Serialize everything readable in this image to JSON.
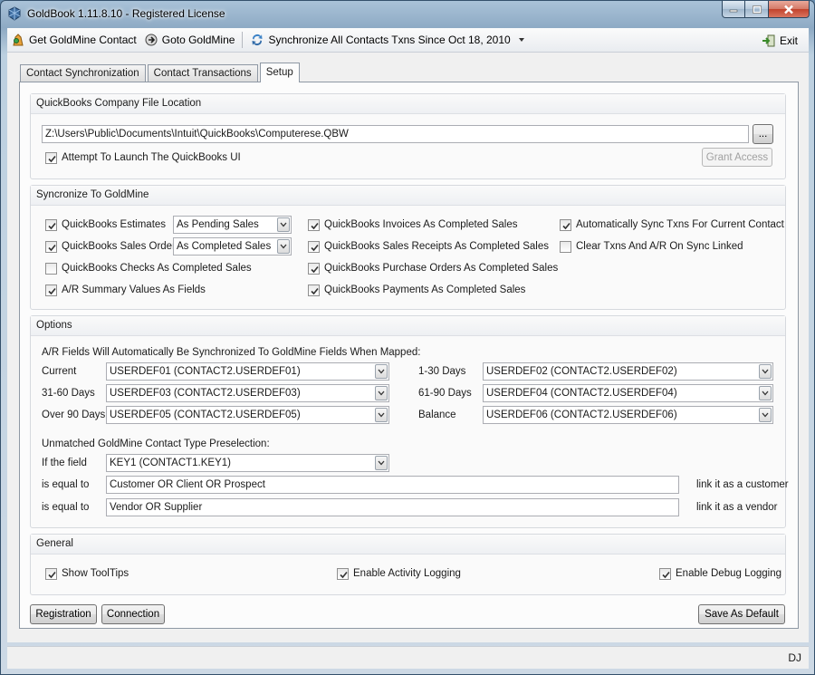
{
  "window": {
    "title": "GoldBook 1.11.8.10 - Registered License"
  },
  "toolbar": {
    "get_contact": "Get GoldMine Contact",
    "goto": "Goto GoldMine",
    "sync_all": "Synchronize All Contacts Txns Since Oct 18, 2010",
    "exit": "Exit"
  },
  "tabs": [
    {
      "label": "Contact Synchronization",
      "active": false
    },
    {
      "label": "Contact Transactions",
      "active": false
    },
    {
      "label": "Setup",
      "active": true
    }
  ],
  "company_file": {
    "header": "QuickBooks Company File Location",
    "path": "Z:\\Users\\Public\\Documents\\Intuit\\QuickBooks\\Computerese.QBW",
    "browse_label": "...",
    "launch_ui_label": "Attempt To Launch The QuickBooks UI",
    "launch_ui_checked": true,
    "grant_access_label": "Grant Access"
  },
  "sync": {
    "header": "Syncronize To GoldMine",
    "estimates": {
      "label": "QuickBooks Estimates",
      "checked": true,
      "mode": "As Pending Sales"
    },
    "sales_orders": {
      "label": "QuickBooks Sales Orders",
      "checked": true,
      "mode": "As Completed Sales"
    },
    "checks": {
      "label": "QuickBooks Checks As Completed Sales",
      "checked": false
    },
    "ar_summary": {
      "label": "A/R Summary Values As Fields",
      "checked": true
    },
    "invoices": {
      "label": "QuickBooks Invoices As Completed Sales",
      "checked": true
    },
    "sales_receipts": {
      "label": "QuickBooks Sales Receipts As Completed Sales",
      "checked": true
    },
    "purchase_orders": {
      "label": "QuickBooks Purchase Orders As Completed Sales",
      "checked": true
    },
    "payments": {
      "label": "QuickBooks Payments As Completed Sales",
      "checked": true
    },
    "auto_sync": {
      "label": "Automatically Sync Txns For Current Contact",
      "checked": true
    },
    "clear_txns": {
      "label": "Clear Txns And A/R On Sync Linked",
      "checked": false
    }
  },
  "options": {
    "header": "Options",
    "ar_note": "A/R Fields Will Automatically Be Synchronized To GoldMine Fields When Mapped:",
    "current": {
      "label": "Current",
      "value": "USERDEF01 (CONTACT2.USERDEF01)"
    },
    "d31_60": {
      "label": "31-60 Days",
      "value": "USERDEF03 (CONTACT2.USERDEF03)"
    },
    "over90": {
      "label": "Over 90 Days",
      "value": "USERDEF05 (CONTACT2.USERDEF05)"
    },
    "d1_30": {
      "label": "1-30 Days",
      "value": "USERDEF02 (CONTACT2.USERDEF02)"
    },
    "d61_90": {
      "label": "61-90 Days",
      "value": "USERDEF04 (CONTACT2.USERDEF04)"
    },
    "balance": {
      "label": "Balance",
      "value": "USERDEF06 (CONTACT2.USERDEF06)"
    },
    "preselect_note": "Unmatched GoldMine Contact Type Preselection:",
    "if_field_label": "If the field",
    "if_field_value": "KEY1 (CONTACT1.KEY1)",
    "equal1_label": "is equal to",
    "equal1_value": "Customer OR Client OR Prospect",
    "link_customer": "link it as a customer",
    "equal2_label": "is equal to",
    "equal2_value": "Vendor OR Supplier",
    "link_vendor": "link it as a vendor"
  },
  "general": {
    "header": "General",
    "tooltips": {
      "label": "Show ToolTips",
      "checked": true
    },
    "activity_log": {
      "label": "Enable Activity Logging",
      "checked": true
    },
    "debug_log": {
      "label": "Enable Debug Logging",
      "checked": true
    }
  },
  "buttons": {
    "registration": "Registration",
    "connection": "Connection",
    "save_default": "Save As Default"
  },
  "status": {
    "user": "DJ"
  }
}
